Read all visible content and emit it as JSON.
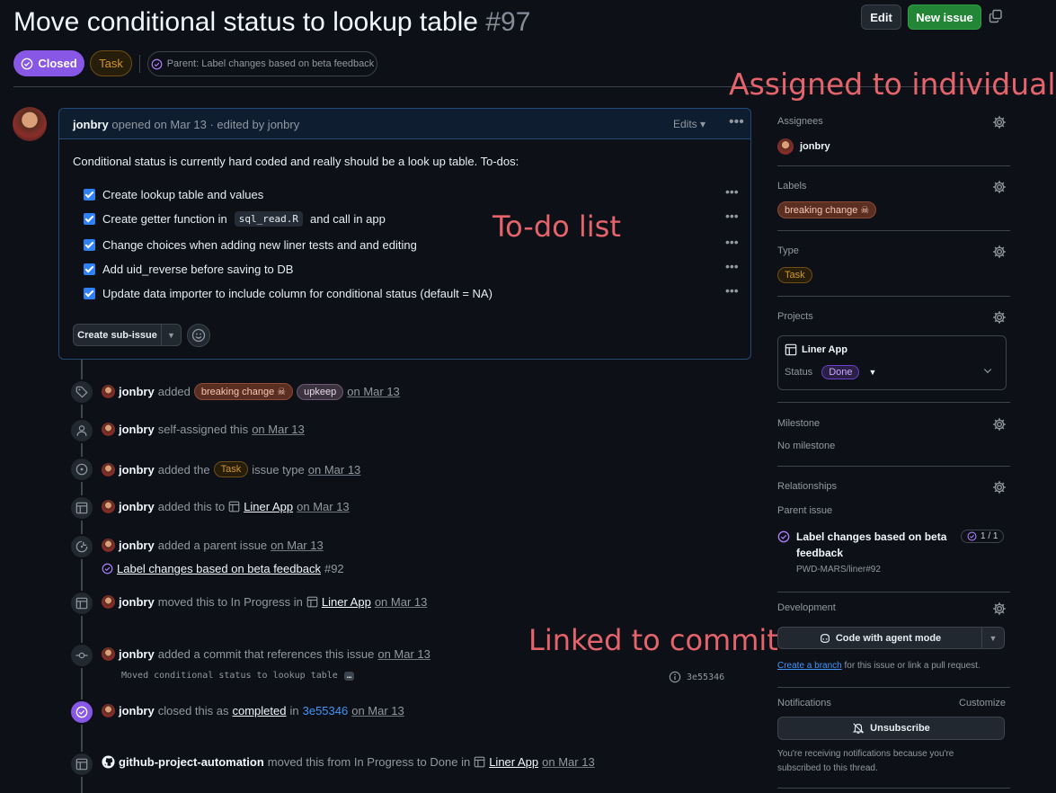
{
  "header": {
    "title": "Move conditional status to lookup table",
    "number": "#97",
    "edit_label": "Edit",
    "new_issue_label": "New issue",
    "state_label": "Closed",
    "type_label": "Task",
    "parent_label": "Parent: Label changes based on beta feedback"
  },
  "annotations": {
    "assigned": "Assigned to individuals",
    "todo": "To-do list",
    "commit": "Linked to commit"
  },
  "comment": {
    "author": "jonbry",
    "meta": "opened on Mar 13 · edited by jonbry",
    "edits_label": "Edits",
    "intro": "Conditional status is currently hard coded and really should be a look up table. To-dos:",
    "todos": [
      "Create lookup table and values",
      "Create getter function in",
      "and call in app",
      "Change choices when adding new liner tests and and editing",
      "Add uid_reverse before saving to DB",
      "Update data importer to include column for conditional status (default = NA)"
    ],
    "todo_code": "sql_read.R",
    "create_sub_issue": "Create sub-issue"
  },
  "timeline": [
    {
      "user": "jonbry",
      "action": "added",
      "labels": [
        "breaking change ☠",
        "upkeep"
      ],
      "date": "on Mar 13"
    },
    {
      "user": "jonbry",
      "action": "self-assigned this",
      "date": "on Mar 13"
    },
    {
      "user": "jonbry",
      "action": "added the",
      "type": "Task",
      "action2": "issue type",
      "date": "on Mar 13"
    },
    {
      "user": "jonbry",
      "action": "added this to",
      "project": "Liner App",
      "date": "on Mar 13"
    },
    {
      "user": "jonbry",
      "action": "added a parent issue",
      "date": "on Mar 13",
      "parent_title": "Label changes based on beta feedback",
      "parent_number": "#92"
    },
    {
      "user": "jonbry",
      "action": "moved this to In Progress in",
      "project": "Liner App",
      "date": "on Mar 13"
    },
    {
      "user": "jonbry",
      "action": "added a commit that references this issue",
      "date": "on Mar 13",
      "commit_message": "Moved conditional status to lookup table",
      "commit_more": "…",
      "commit_sha": "3e55346"
    },
    {
      "user": "jonbry",
      "action": "closed this as",
      "completed": "completed",
      "in": "in",
      "sha": "3e55346",
      "date": "on Mar 13"
    },
    {
      "user": "github-project-automation",
      "action": "moved this from In Progress to Done in",
      "project": "Liner App",
      "date": "on Mar 13"
    }
  ],
  "sidebar": {
    "assignees_label": "Assignees",
    "assignee": "jonbry",
    "labels_label": "Labels",
    "label": "breaking change ☠",
    "type_label": "Type",
    "type": "Task",
    "projects_label": "Projects",
    "project_name": "Liner App",
    "status_label": "Status",
    "status_value": "Done",
    "milestone_label": "Milestone",
    "milestone_value": "No milestone",
    "relationships_label": "Relationships",
    "parent_issue_label": "Parent issue",
    "parent_title": "Label changes based on beta feedback",
    "parent_count": "1 / 1",
    "parent_repo": "PWD-MARS/liner#92",
    "development_label": "Development",
    "agent_button": "Code with agent mode",
    "create_branch": "Create a branch",
    "branch_rest": "for this issue or link a pull request.",
    "notifications_label": "Notifications",
    "customize": "Customize",
    "unsubscribe": "Unsubscribe",
    "notif_text": "You're receiving notifications because you're subscribed to this thread."
  },
  "colors": {
    "background": "#0d1117",
    "closed_purple": "#8957e5",
    "primary_green": "#238636",
    "annotation_red": "#e5646b",
    "link_blue": "#4493f8"
  }
}
